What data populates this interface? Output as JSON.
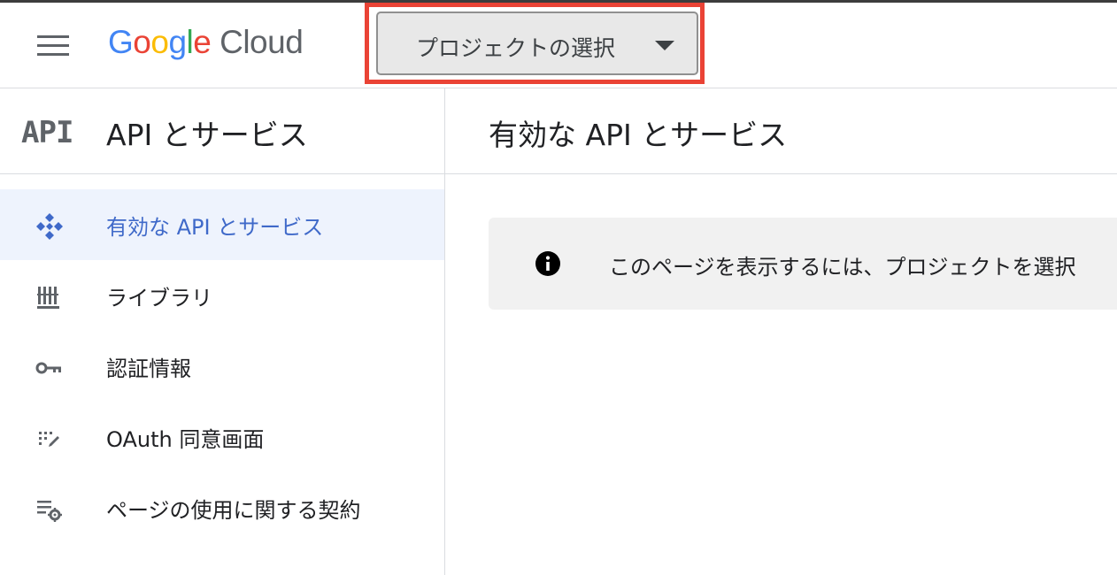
{
  "header": {
    "logo": {
      "google": [
        "G",
        "o",
        "o",
        "g",
        "l",
        "e"
      ],
      "cloud": "Cloud"
    },
    "project_picker": {
      "label": "プロジェクトの選択"
    }
  },
  "sidebar": {
    "title": "API とサービス",
    "logo_text": "API",
    "items": [
      {
        "label": "有効な API とサービス",
        "icon": "api-services-icon",
        "active": true
      },
      {
        "label": "ライブラリ",
        "icon": "library-icon",
        "active": false
      },
      {
        "label": "認証情報",
        "icon": "key-icon",
        "active": false
      },
      {
        "label": "OAuth 同意画面",
        "icon": "oauth-consent-icon",
        "active": false
      },
      {
        "label": "ページの使用に関する契約",
        "icon": "page-usage-settings-icon",
        "active": false
      }
    ]
  },
  "main": {
    "title": "有効な API とサービス",
    "banner": {
      "icon": "info-icon",
      "text": "このページを表示するには、プロジェクトを選択"
    }
  },
  "colors": {
    "accent": "#3f69c9",
    "active_bg": "#eef3fd",
    "highlight_border": "#ea4335",
    "google_blue": "#4285f4",
    "google_red": "#ea4335",
    "google_yellow": "#fbbc05",
    "google_green": "#34a853"
  }
}
